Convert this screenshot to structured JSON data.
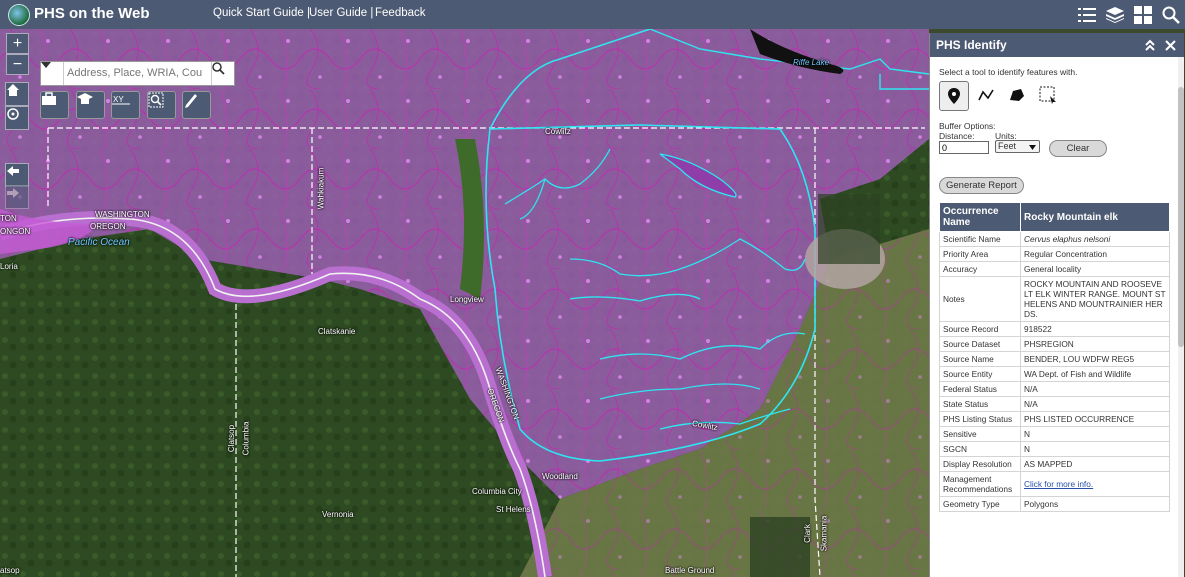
{
  "header": {
    "title": "PHS on the Web",
    "links": [
      "Quick Start Guide |",
      "User Guide |",
      "Feedback"
    ],
    "icons": [
      "list-icon",
      "layers-icon",
      "grid-icon",
      "phs-identify-icon"
    ]
  },
  "map": {
    "search_placeholder": "Address, Place, WRIA, Cou",
    "zoom_in": "+",
    "zoom_out": "−",
    "labels": {
      "washington1": "WASHINGTON",
      "oregon1": "OREGON",
      "pacific": "Pacific Ocean",
      "washington2": "WASHINGTON",
      "oregon2": "OREGON",
      "ilwaco": "ONGON",
      "loria": "Loria",
      "longview": "Longview",
      "clatskanie": "Clatskanie",
      "kelso": "Cowlitz",
      "wahkiakum": "Wahkiakum",
      "columbia_city": "Columbia City",
      "st_helens": "St Helens",
      "woodland": "Woodland",
      "vernonia": "Vernonia",
      "clatsop": "Clatsop",
      "columbia_co": "Columbia",
      "clark": "Clark",
      "skamania": "Skamania",
      "cowlitz_r": "Cowlitz",
      "battle_ground": "Battle Ground",
      "riffe_lake": "Riffe Lake",
      "clatsop2": "atsop",
      "washington_left": "TON"
    },
    "colors": {
      "overlay": "#b04fc7",
      "boundary": "#2ee6f2",
      "forest": "#2e4a22"
    }
  },
  "panel": {
    "title": "PHS Identify",
    "instruction": "Select a tool to identify features with.",
    "tools": [
      "point-tool-icon",
      "line-tool-icon",
      "polygon-tool-icon",
      "extent-tool-icon"
    ],
    "buffer_label": "Buffer Options:",
    "distance_label": "Distance:",
    "units_label": "Units:",
    "distance_value": "0",
    "units_value": "Feet",
    "clear_label": "Clear",
    "report_label": "Generate Report",
    "table_header": {
      "key": "Occurrence Name",
      "value": "Rocky Mountain elk"
    },
    "rows": [
      {
        "k": "Scientific Name",
        "v": "Cervus elaphus nelsoni"
      },
      {
        "k": "Priority Area",
        "v": "Regular Concentration"
      },
      {
        "k": "Accuracy",
        "v": "General locality"
      },
      {
        "k": "Notes",
        "v": "ROCKY MOUNTAIN AND ROOSEVELT ELK WINTER RANGE. MOUNT ST HELENS AND MOUNTRAINIER HERDS."
      },
      {
        "k": "Source Record",
        "v": "918522"
      },
      {
        "k": "Source Dataset",
        "v": "PHSREGION"
      },
      {
        "k": "Source Name",
        "v": "BENDER, LOU WDFW REG5"
      },
      {
        "k": "Source Entity",
        "v": "WA Dept. of Fish and Wildlife"
      },
      {
        "k": "Federal Status",
        "v": "N/A"
      },
      {
        "k": "State Status",
        "v": "N/A"
      },
      {
        "k": "PHS Listing Status",
        "v": "PHS LISTED OCCURRENCE"
      },
      {
        "k": "Sensitive",
        "v": "N"
      },
      {
        "k": "SGCN",
        "v": "N"
      },
      {
        "k": "Display Resolution",
        "v": "AS MAPPED"
      },
      {
        "k": "Management Recommendations",
        "v": "Click for more info."
      },
      {
        "k": "Geometry Type",
        "v": "Polygons"
      }
    ]
  }
}
